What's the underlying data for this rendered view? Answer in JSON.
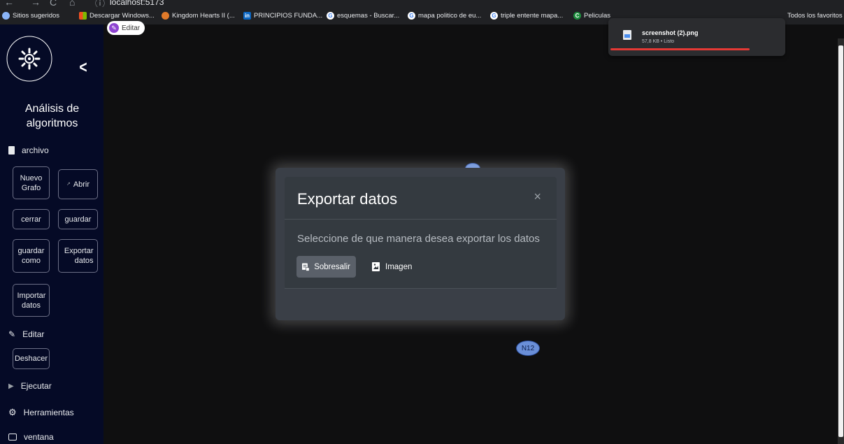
{
  "browser": {
    "url": "localhost:5173",
    "bookmarks": [
      {
        "label": "Sitios sugeridos",
        "icon": "globe-icon"
      },
      {
        "label": "Descargar Windows...",
        "icon": "windows-icon"
      },
      {
        "label": "Kingdom Hearts II (...",
        "icon": "kingdom-hearts-icon"
      },
      {
        "label": "PRINCIPIOS FUNDA...",
        "icon": "linkedin-icon"
      },
      {
        "label": "esquemas - Buscar...",
        "icon": "google-icon"
      },
      {
        "label": "mapa politico de eu...",
        "icon": "google-icon"
      },
      {
        "label": "triple entente mapa...",
        "icon": "google-icon"
      },
      {
        "label": "Peliculas",
        "icon": "c-icon"
      }
    ],
    "all_bookmarks": "Todos los favoritos"
  },
  "download": {
    "filename": "screenshot (2).png",
    "status": "57,8 KB • Listo",
    "progress": 1.0
  },
  "sidebar": {
    "title": "Análisis de algoritmos",
    "archivo": "archivo",
    "nuevo_grafo": "Nuevo Grafo",
    "abrir": "Abrir",
    "cerrar": "cerrar",
    "guardar": "guardar",
    "guardar_como": "guardar como",
    "exportar_datos": "Exportar datos",
    "importar_datos": "Importar datos",
    "editar": "Editar",
    "deshacer": "Deshacer",
    "ejecutar": "Ejecutar",
    "herramientas": "Herramientas",
    "ventana": "ventana"
  },
  "canvas": {
    "edit_chip": "Editar",
    "node_label": "N12"
  },
  "modal": {
    "title": "Exportar datos",
    "close": "×",
    "body": "Seleccione de que manera desea exportar los datos",
    "btn_excel": "Sobresalir",
    "btn_image": "Imagen"
  }
}
